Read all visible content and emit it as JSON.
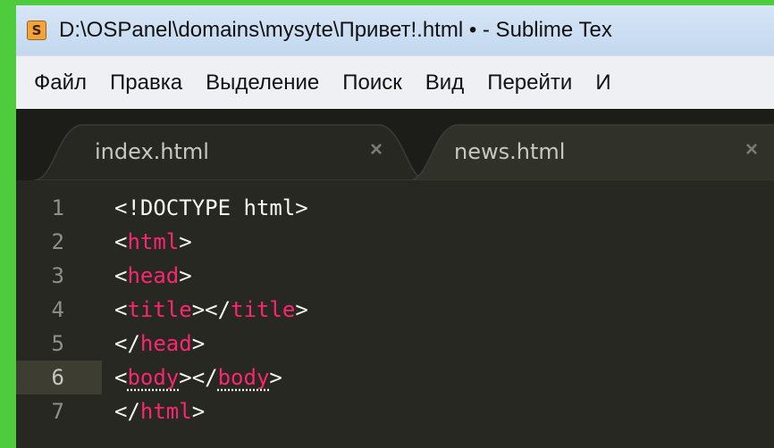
{
  "window": {
    "title": "D:\\OSPanel\\domains\\mysyte\\Привет!.html • - Sublime Tex"
  },
  "menu": {
    "items": [
      "Файл",
      "Правка",
      "Выделение",
      "Поиск",
      "Вид",
      "Перейти",
      "И"
    ]
  },
  "tabs": [
    {
      "label": "index.html",
      "close": "×",
      "active": true
    },
    {
      "label": "news.html",
      "close": "×",
      "active": false
    }
  ],
  "editor": {
    "active_line": 6,
    "lines": [
      {
        "number": "1",
        "tokens": [
          {
            "t": "<!DOCTYPE html>",
            "c": "plain"
          }
        ]
      },
      {
        "number": "2",
        "tokens": [
          {
            "t": "<",
            "c": "punct"
          },
          {
            "t": "html",
            "c": "tag"
          },
          {
            "t": ">",
            "c": "punct"
          }
        ]
      },
      {
        "number": "3",
        "tokens": [
          {
            "t": "<",
            "c": "punct"
          },
          {
            "t": "head",
            "c": "tag"
          },
          {
            "t": ">",
            "c": "punct"
          }
        ]
      },
      {
        "number": "4",
        "tokens": [
          {
            "t": "<",
            "c": "punct"
          },
          {
            "t": "title",
            "c": "tag"
          },
          {
            "t": "></",
            "c": "punct"
          },
          {
            "t": "title",
            "c": "tag"
          },
          {
            "t": ">",
            "c": "punct"
          }
        ]
      },
      {
        "number": "5",
        "tokens": [
          {
            "t": "</",
            "c": "punct"
          },
          {
            "t": "head",
            "c": "tag"
          },
          {
            "t": ">",
            "c": "punct"
          }
        ]
      },
      {
        "number": "6",
        "tokens": [
          {
            "t": "<",
            "c": "punct"
          },
          {
            "t": "body",
            "c": "tag underline"
          },
          {
            "t": "></",
            "c": "punct"
          },
          {
            "t": "body",
            "c": "tag underline"
          },
          {
            "t": ">",
            "c": "punct"
          }
        ]
      },
      {
        "number": "7",
        "tokens": [
          {
            "t": "</",
            "c": "punct"
          },
          {
            "t": "html",
            "c": "tag"
          },
          {
            "t": ">",
            "c": "punct"
          }
        ]
      }
    ]
  },
  "colors": {
    "background_outer": "#4fcc3e",
    "editor_bg": "#272822",
    "tag": "#f92672",
    "text": "#f8f8f2",
    "gutter": "#8f908a"
  },
  "icons": {
    "app": "sublime-text-icon",
    "close": "close-icon"
  }
}
